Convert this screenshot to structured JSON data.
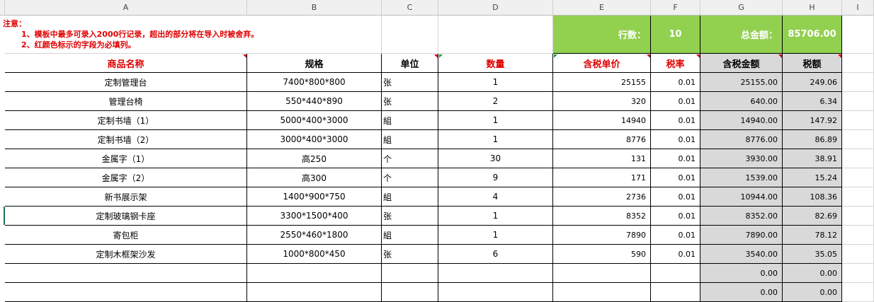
{
  "columns": [
    "A",
    "B",
    "C",
    "D",
    "E",
    "F",
    "G",
    "H",
    "I"
  ],
  "notes": {
    "title": "注意：",
    "line1": "1、模板中最多可录入2000行记录，超出的部分将在导入时被舍弃。",
    "line2": "2、红颜色标示的字段为必填列。"
  },
  "summary": {
    "row_count_label": "行数：",
    "row_count_value": "10",
    "total_label": "总金额：",
    "total_value": "85706.00"
  },
  "headers": {
    "name": "商品名称",
    "spec": "规格",
    "unit": "单位",
    "qty": "数量",
    "price": "含税单价",
    "rate": "税率",
    "amount": "含税金额",
    "tax": "税额"
  },
  "rows": [
    {
      "name": "定制管理台",
      "spec": "7400*800*800",
      "unit": "张",
      "qty": "1",
      "price": "25155",
      "rate": "0.01",
      "amount": "25155.00",
      "tax": "249.06"
    },
    {
      "name": "管理台椅",
      "spec": "550*440*890",
      "unit": "张",
      "qty": "2",
      "price": "320",
      "rate": "0.01",
      "amount": "640.00",
      "tax": "6.34"
    },
    {
      "name": "定制书墙（1）",
      "spec": "5000*400*3000",
      "unit": "組",
      "qty": "1",
      "price": "14940",
      "rate": "0.01",
      "amount": "14940.00",
      "tax": "147.92"
    },
    {
      "name": "定制书墙（2）",
      "spec": "3000*400*3000",
      "unit": "組",
      "qty": "1",
      "price": "8776",
      "rate": "0.01",
      "amount": "8776.00",
      "tax": "86.89"
    },
    {
      "name": "金属字（1）",
      "spec": "高250",
      "unit": "个",
      "qty": "30",
      "price": "131",
      "rate": "0.01",
      "amount": "3930.00",
      "tax": "38.91"
    },
    {
      "name": "金属字（2）",
      "spec": "高300",
      "unit": "个",
      "qty": "9",
      "price": "171",
      "rate": "0.01",
      "amount": "1539.00",
      "tax": "15.24"
    },
    {
      "name": "新书展示架",
      "spec": "1400*900*750",
      "unit": "組",
      "qty": "4",
      "price": "2736",
      "rate": "0.01",
      "amount": "10944.00",
      "tax": "108.36"
    },
    {
      "name": "定制玻璃钢卡座",
      "spec": "3300*1500*400",
      "unit": "张",
      "qty": "1",
      "price": "8352",
      "rate": "0.01",
      "amount": "8352.00",
      "tax": "82.69"
    },
    {
      "name": "寄包柜",
      "spec": "2550*460*1800",
      "unit": "組",
      "qty": "1",
      "price": "7890",
      "rate": "0.01",
      "amount": "7890.00",
      "tax": "78.12"
    },
    {
      "name": "定制木框架沙发",
      "spec": "1000*800*450",
      "unit": "张",
      "qty": "6",
      "price": "590",
      "rate": "0.01",
      "amount": "3540.00",
      "tax": "35.05"
    },
    {
      "name": "",
      "spec": "",
      "unit": "",
      "qty": "",
      "price": "",
      "rate": "",
      "amount": "0.00",
      "tax": "0.00"
    },
    {
      "name": "",
      "spec": "",
      "unit": "",
      "qty": "",
      "price": "",
      "rate": "",
      "amount": "0.00",
      "tax": "0.00"
    }
  ],
  "colors": {
    "summary_green": "#92d050",
    "required_red": "#e00000",
    "computed_gray": "#d9d9d9"
  }
}
